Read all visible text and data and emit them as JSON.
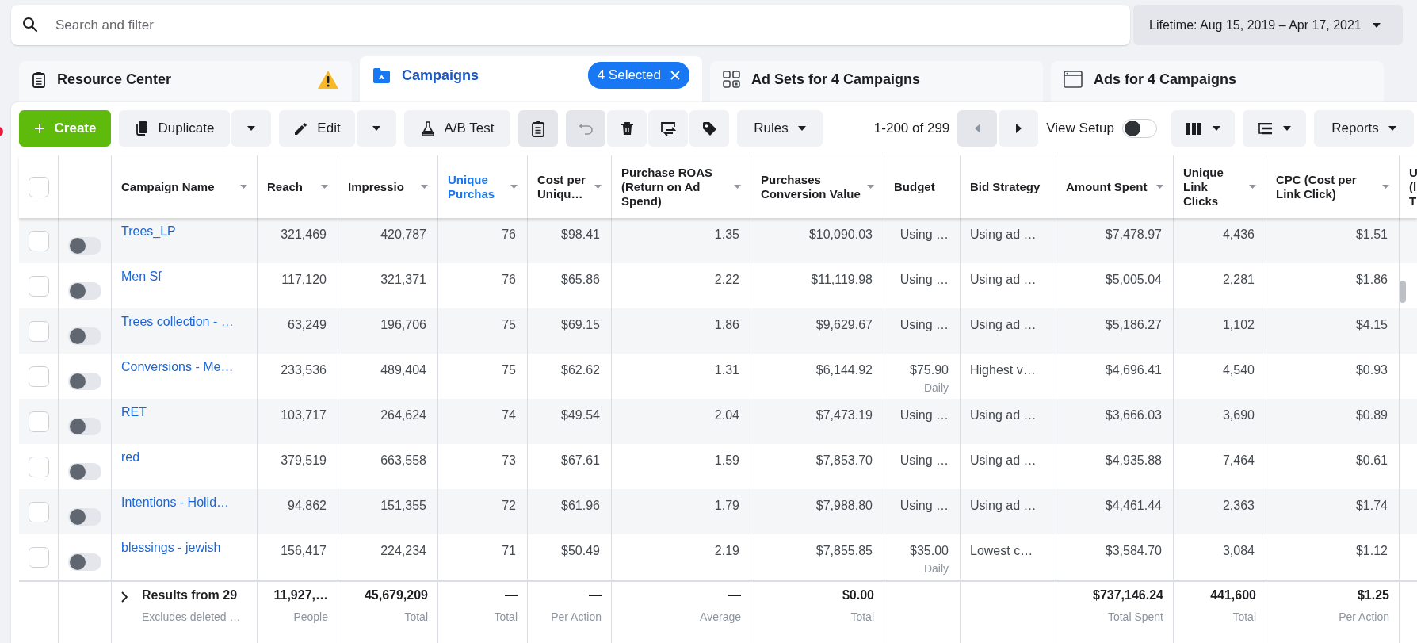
{
  "search": {
    "placeholder": "Search and filter"
  },
  "date_range": {
    "label": "Lifetime: Aug 15, 2019 – Apr 17, 2021"
  },
  "tabs": [
    {
      "kind": "resource",
      "label": "Resource Center",
      "selected": false,
      "warning": true
    },
    {
      "kind": "campaigns",
      "label": "Campaigns",
      "selected": true,
      "badge": "4 Selected"
    },
    {
      "kind": "adsets",
      "label": "Ad Sets for 4 Campaigns",
      "selected": false
    },
    {
      "kind": "ads",
      "label": "Ads for 4 Campaigns",
      "selected": false
    }
  ],
  "toolbar": {
    "create": "Create",
    "duplicate": "Duplicate",
    "edit": "Edit",
    "ab_test": "A/B Test",
    "rules": "Rules",
    "pagination": "1-200 of 299",
    "prev_disabled": true,
    "view_setup": {
      "label": "View Setup",
      "on": false
    },
    "reports": "Reports"
  },
  "table": {
    "select_all": {
      "checked": false
    },
    "columns": [
      {
        "label": "Campaign Name",
        "kind": "name",
        "caret": true,
        "sorted": false
      },
      {
        "label": "Reach",
        "kind": "number",
        "caret": true,
        "sorted": false
      },
      {
        "label": "Impressio",
        "kind": "number",
        "caret": true,
        "sorted": false
      },
      {
        "label": "Unique Purchas",
        "kind": "number",
        "caret": true,
        "sorted": true
      },
      {
        "label": "Cost per Uniqu…",
        "kind": "number",
        "caret": true,
        "sorted": false
      },
      {
        "label": "Purchase ROAS (Return on Ad Spend)",
        "kind": "number",
        "caret": true,
        "sorted": false
      },
      {
        "label": "Purchases Conversion Value",
        "kind": "number",
        "caret": true,
        "sorted": false
      },
      {
        "label": "Budget",
        "kind": "number",
        "caret": false,
        "sorted": false
      },
      {
        "label": "Bid Strategy",
        "kind": "text",
        "caret": false,
        "sorted": false
      },
      {
        "label": "Amount Spent",
        "kind": "number",
        "caret": true,
        "sorted": false
      },
      {
        "label": "Unique Link Clicks",
        "kind": "number",
        "caret": true,
        "sorted": false
      },
      {
        "label": "CPC (Cost per Link Click)",
        "kind": "number",
        "caret": true,
        "sorted": false
      },
      {
        "label": "U (l T",
        "kind": "text",
        "caret": false,
        "sorted": false
      }
    ],
    "rows": [
      {
        "checked": false,
        "on": false,
        "values": [
          "Trees_LP",
          "321,469",
          "420,787",
          "76",
          "$98.41",
          "1.35",
          "$10,090.03",
          {
            "text": "Using …"
          },
          "Using ad …",
          "$7,478.97",
          "4,436",
          "$1.51"
        ]
      },
      {
        "checked": false,
        "on": false,
        "values": [
          "Men Sf",
          "117,120",
          "321,371",
          "76",
          "$65.86",
          "2.22",
          "$11,119.98",
          {
            "text": "Using …"
          },
          "Using ad …",
          "$5,005.04",
          "2,281",
          "$1.86"
        ]
      },
      {
        "checked": false,
        "on": false,
        "values": [
          "Trees collection - …",
          "63,249",
          "196,706",
          "75",
          "$69.15",
          "1.86",
          "$9,629.67",
          {
            "text": "Using …"
          },
          "Using ad …",
          "$5,186.27",
          "1,102",
          "$4.15"
        ]
      },
      {
        "checked": false,
        "on": false,
        "values": [
          "Conversions - Me…",
          "233,536",
          "489,404",
          "75",
          "$62.62",
          "1.31",
          "$6,144.92",
          {
            "text": "$75.90",
            "note": "Daily"
          },
          "Highest v…",
          "$4,696.41",
          "4,540",
          "$0.93"
        ]
      },
      {
        "checked": false,
        "on": false,
        "values": [
          "RET",
          "103,717",
          "264,624",
          "74",
          "$49.54",
          "2.04",
          "$7,473.19",
          {
            "text": "Using …"
          },
          "Using ad …",
          "$3,666.03",
          "3,690",
          "$0.89"
        ]
      },
      {
        "checked": false,
        "on": false,
        "values": [
          "red",
          "379,519",
          "663,558",
          "73",
          "$67.61",
          "1.59",
          "$7,853.70",
          {
            "text": "Using …"
          },
          "Using ad …",
          "$4,935.88",
          "7,464",
          "$0.61"
        ]
      },
      {
        "checked": false,
        "on": false,
        "values": [
          "Intentions - Holid…",
          "94,862",
          "151,355",
          "72",
          "$61.96",
          "1.79",
          "$7,988.80",
          {
            "text": "Using …"
          },
          "Using ad …",
          "$4,461.44",
          "2,363",
          "$1.74"
        ]
      },
      {
        "checked": false,
        "on": false,
        "values": [
          "blessings - jewish",
          "156,417",
          "224,234",
          "71",
          "$50.49",
          "2.19",
          "$7,855.85",
          {
            "text": "$35.00",
            "note": "Daily"
          },
          "Lowest c…",
          "$3,584.70",
          "3,084",
          "$1.12"
        ]
      }
    ],
    "footer": {
      "expanded": false,
      "cells": [
        {
          "text": "Results from 29",
          "note": "Excludes deleted …"
        },
        {
          "text": "11,927,…",
          "note": "People"
        },
        {
          "text": "45,679,209",
          "note": "Total"
        },
        {
          "text": "—",
          "note": "Total"
        },
        {
          "text": "—",
          "note": "Per Action"
        },
        {
          "text": "—",
          "note": "Average"
        },
        {
          "text": "$0.00",
          "note": "Total"
        },
        null,
        null,
        {
          "text": "$737,146.24",
          "note": "Total Spent"
        },
        {
          "text": "441,600",
          "note": "Total"
        },
        {
          "text": "$1.25",
          "note": "Per Action"
        }
      ]
    }
  }
}
